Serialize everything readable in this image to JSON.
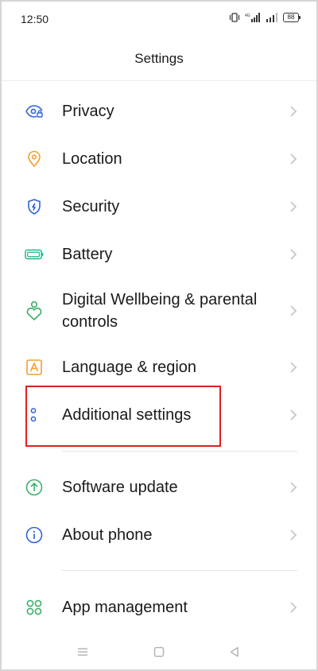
{
  "status_bar": {
    "time": "12:50",
    "battery": "88",
    "icons": [
      "vibrate-icon",
      "signal-icon",
      "signal-icon",
      "battery-icon"
    ]
  },
  "header": {
    "title": "Settings"
  },
  "settings": {
    "items": [
      {
        "label": "Privacy",
        "icon": "privacy-eye-lock-icon",
        "color": "#2f63d6"
      },
      {
        "label": "Location",
        "icon": "location-pin-icon",
        "color": "#f0a032"
      },
      {
        "label": "Security",
        "icon": "shield-icon",
        "color": "#2f63d6"
      },
      {
        "label": "Battery",
        "icon": "battery-icon",
        "color": "#1cb88a"
      },
      {
        "label": "Digital Wellbeing & parental controls",
        "icon": "wellbeing-heart-person-icon",
        "color": "#3bb06a"
      },
      {
        "label": "Language & region",
        "icon": "language-a-icon",
        "color": "#f0a032"
      },
      {
        "label": "Additional settings",
        "icon": "additional-dots-icon",
        "color": "#2f63d6"
      },
      {
        "label": "Software update",
        "icon": "update-arrow-icon",
        "color": "#3bb06a"
      },
      {
        "label": "About phone",
        "icon": "info-icon",
        "color": "#2f63d6"
      },
      {
        "label": "App management",
        "icon": "app-grid-icon",
        "color": "#3bb06a"
      }
    ]
  },
  "highlight_color": "#e02020",
  "nav_bar": {
    "icons": [
      "menu-icon",
      "home-icon",
      "back-icon"
    ]
  }
}
